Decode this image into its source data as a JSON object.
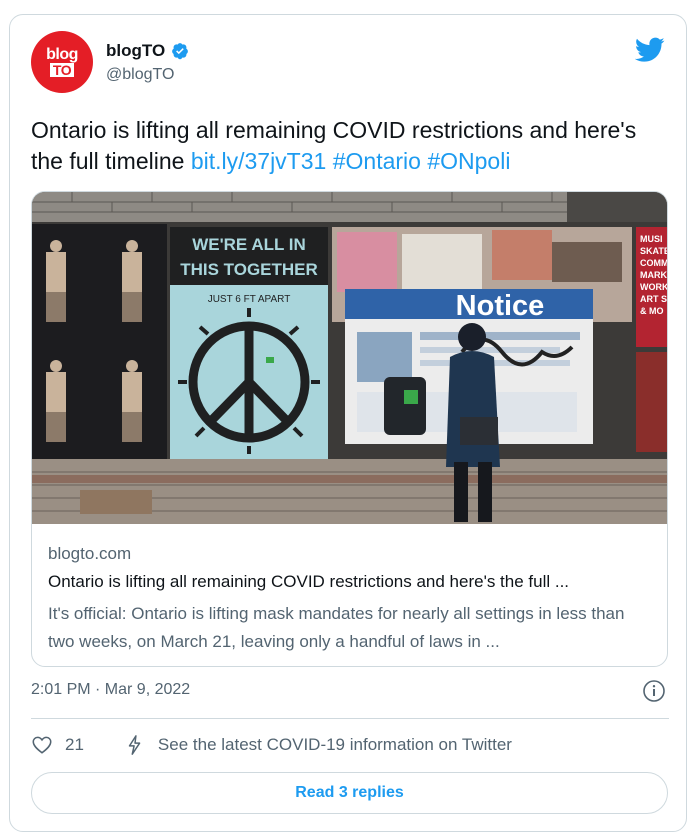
{
  "author": {
    "avatar_text_top": "blog",
    "avatar_text_bottom": "TO",
    "name": "blogTO",
    "handle": "@blogTO"
  },
  "tweet": {
    "text": "Ontario is lifting all remaining COVID restrictions and here's the full timeline ",
    "link": "bit.ly/37jvT31",
    "hashtag1": "#Ontario",
    "hashtag2": "#ONpoli"
  },
  "photo": {
    "poster_left_line1": "WE'RE ALL IN",
    "poster_left_line2": "THIS TOGETHER",
    "poster_left_line3": "JUST 6 FT APART",
    "poster_notice": "Notice",
    "poster_right_lines": [
      "MUSI",
      "SKATE",
      "COMM",
      "MARK",
      "WORK",
      "ART S",
      "& MO"
    ]
  },
  "link_card": {
    "domain": "blogto.com",
    "title": "Ontario is lifting all remaining COVID restrictions and here's the full ...",
    "description": "It's official: Ontario is lifting mask mandates for nearly all settings in less than two weeks, on March 21, leaving only a handful of laws in ..."
  },
  "meta": {
    "timestamp": "2:01 PM · Mar 9, 2022"
  },
  "actions": {
    "likes": "21",
    "covid_info": "See the latest COVID-19 information on Twitter"
  },
  "read_replies": "Read 3 replies",
  "colors": {
    "accent": "#1d9bf0",
    "avatar_bg": "#e41e26",
    "border": "#cfd9de",
    "secondary_text": "#536471"
  }
}
